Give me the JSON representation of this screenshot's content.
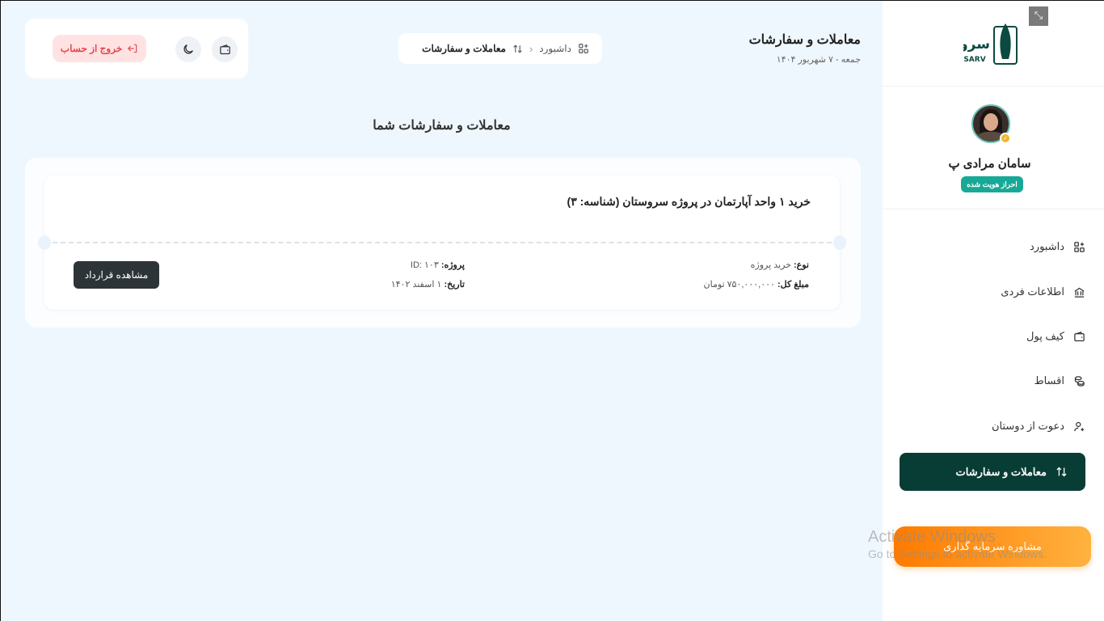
{
  "window": {
    "expand_icon": "collapse-arrows-icon"
  },
  "sidebar": {
    "logo_text": "سرو",
    "logo_subtext": "SARV",
    "user": {
      "name": "سامان مرادی پ",
      "verified_label": "احراز هویت شده"
    },
    "items": [
      {
        "label": "داشبورد",
        "icon": "dashboard-grid-icon",
        "active": false
      },
      {
        "label": "اطلاعات فردی",
        "icon": "bank-building-icon",
        "active": false
      },
      {
        "label": "کیف پول",
        "icon": "wallet-icon",
        "active": false
      },
      {
        "label": "اقساط",
        "icon": "installments-coins-icon",
        "active": false
      },
      {
        "label": "دعوت از دوستان",
        "icon": "user-plus-icon",
        "active": false
      },
      {
        "label": "معاملات و سفارشات",
        "icon": "swap-arrows-icon",
        "active": true
      }
    ],
    "cta_label": "مشاوره سرمایه گذاری",
    "colors": {
      "active_bg": "#073d35",
      "badge": "#18a996",
      "cta": "#ff8c00"
    }
  },
  "header": {
    "title": "معاملات و سفارشات",
    "date": "جمعه - ۷ شهریور ۱۴۰۴",
    "breadcrumb": {
      "home": "داشبورد",
      "current": "معاملات و سفارشات"
    },
    "logout_label": "خروج از حساب"
  },
  "main": {
    "section_title": "معاملات و سفارشات شما",
    "deal": {
      "title": "خرید ۱ واحد آپارتمان در پروژه سروستان (شناسه: ۳)",
      "type_label": "نوع:",
      "type_value": "خرید پروژه",
      "amount_label": "مبلغ کل:",
      "amount_value": "۷۵۰,۰۰۰,۰۰۰ تومان",
      "project_label": "پروژه:",
      "project_value": "ID: ۱۰۳",
      "date_label": "تاریخ:",
      "date_value": "۱ اسفند ۱۴۰۲",
      "contract_button": "مشاهده قرارداد"
    }
  },
  "os_watermark": {
    "line1": "Activate Windows",
    "line2": "Go to Settings to activate Windows."
  }
}
